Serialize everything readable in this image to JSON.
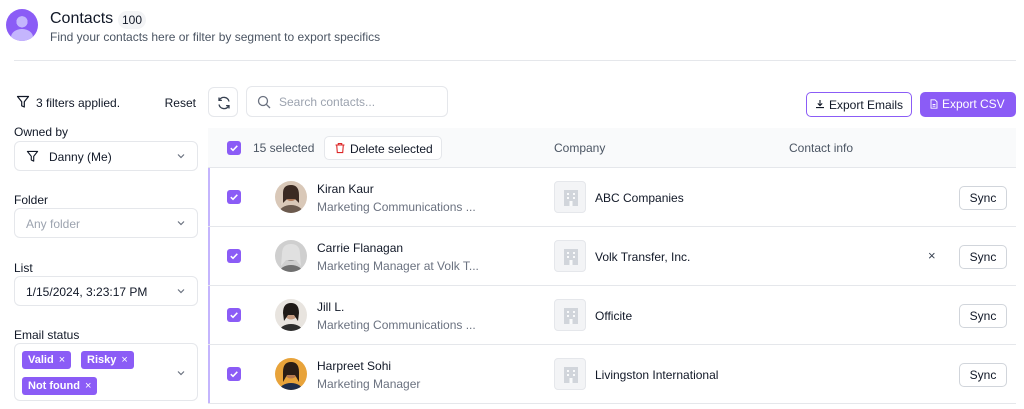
{
  "header": {
    "title": "Contacts",
    "count": "100",
    "subtitle": "Find your contacts here or filter by segment to export specifics"
  },
  "filters": {
    "applied_text": "3 filters applied.",
    "reset_label": "Reset",
    "owned_by": {
      "label": "Owned by",
      "value": "Danny (Me)"
    },
    "folder": {
      "label": "Folder",
      "placeholder": "Any folder"
    },
    "list": {
      "label": "List",
      "value": "1/15/2024, 3:23:17 PM"
    },
    "email_status": {
      "label": "Email status",
      "tags": [
        "Valid",
        "Risky",
        "Not found"
      ]
    }
  },
  "toolbar": {
    "search_placeholder": "Search contacts...",
    "export_emails_label": "Export Emails",
    "export_csv_label": "Export CSV"
  },
  "table": {
    "selected_text": "15 selected",
    "delete_label": "Delete selected",
    "col_company": "Company",
    "col_contact_info": "Contact info",
    "sync_label": "Sync",
    "remove_glyph": "×",
    "rows": [
      {
        "name": "Kiran Kaur",
        "title": "Marketing Communications ...",
        "company": "ABC Companies",
        "checked": true
      },
      {
        "name": "Carrie Flanagan",
        "title": "Marketing Manager at Volk T...",
        "company": "Volk Transfer, Inc.",
        "checked": true
      },
      {
        "name": "Jill L.",
        "title": "Marketing Communications ...",
        "company": "Officite",
        "checked": true
      },
      {
        "name": "Harpreet Sohi",
        "title": "Marketing Manager",
        "company": "Livingston International",
        "checked": true
      }
    ]
  },
  "colors": {
    "accent": "#8b5cf6",
    "accent_light": "#c4b5fd",
    "delete_red": "#dc2626"
  }
}
